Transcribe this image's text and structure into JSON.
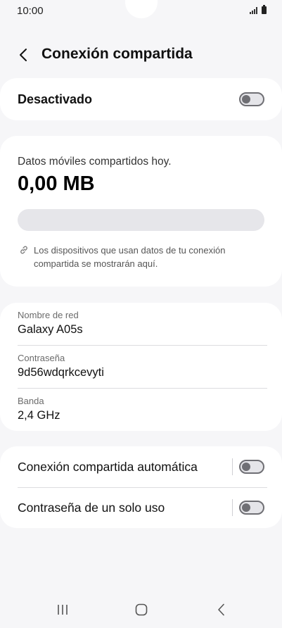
{
  "status_bar": {
    "time": "10:00",
    "icons": [
      "signal-icon",
      "battery-icon"
    ]
  },
  "header": {
    "title": "Conexión compartida",
    "back_icon": "chevron-left-icon"
  },
  "main_toggle": {
    "label": "Desactivado",
    "state": "off"
  },
  "usage": {
    "label": "Datos móviles compartidos hoy.",
    "value": "0,00 MB",
    "progress_fraction": 0,
    "info_icon": "link-icon",
    "info_text": "Los dispositivos que usan datos de tu conexión compartida se mostrarán aquí."
  },
  "network": {
    "fields": [
      {
        "label": "Nombre de red",
        "value": "Galaxy A05s"
      },
      {
        "label": "Contraseña",
        "value": "9d56wdqrkcevyti"
      },
      {
        "label": "Banda",
        "value": "2,4 GHz"
      }
    ]
  },
  "options": [
    {
      "label": "Conexión compartida automática",
      "state": "off"
    },
    {
      "label": "Contraseña de un solo uso",
      "state": "off"
    }
  ],
  "nav_bar": {
    "icons": [
      "recent-apps-icon",
      "home-icon",
      "back-icon"
    ]
  },
  "colors": {
    "background": "#f6f6f8",
    "card": "#ffffff",
    "toggle_off": "#6f6f74",
    "progress_track": "#e6e6ea",
    "accent": "#3e91ff"
  }
}
